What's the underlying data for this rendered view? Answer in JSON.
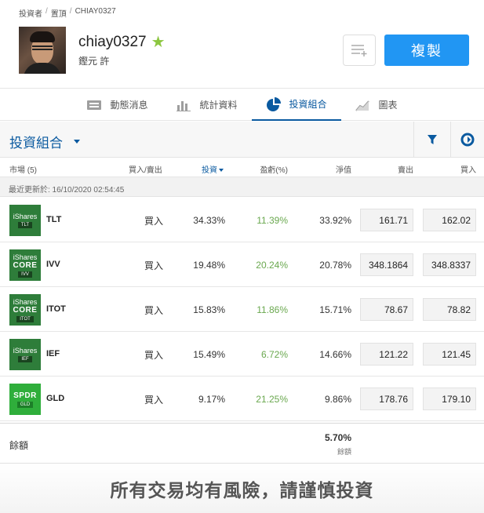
{
  "breadcrumb": {
    "items": [
      "投資者",
      "置頂",
      "CHIAY0327"
    ]
  },
  "profile": {
    "username": "chiay0327",
    "real_name": "鏗元 許"
  },
  "actions": {
    "copy_label": "複製"
  },
  "tabs": [
    {
      "label": "動態消息",
      "icon": "news-icon"
    },
    {
      "label": "統計資料",
      "icon": "stats-icon"
    },
    {
      "label": "投資組合",
      "icon": "portfolio-icon",
      "active": true
    },
    {
      "label": "圖表",
      "icon": "chart-icon"
    }
  ],
  "portfolio": {
    "title": "投資組合",
    "columns": {
      "market": "市場 (5)",
      "direction": "買入/賣出",
      "invested": "投資",
      "pl": "盈虧(%)",
      "net_value": "淨值",
      "sell": "賣出",
      "buy": "買入"
    },
    "last_updated": "最近更新於: 16/10/2020 02:54:45",
    "rows": [
      {
        "symbol": "TLT",
        "brand": "iShares",
        "brand2": "",
        "logo_ticker": "TLT",
        "direction": "買入",
        "invested": "34.33%",
        "pl": "11.39%",
        "net_value": "33.92%",
        "sell": "161.71",
        "buy": "162.02"
      },
      {
        "symbol": "IVV",
        "brand": "iShares",
        "brand2": "CORE",
        "logo_ticker": "IVV",
        "direction": "買入",
        "invested": "19.48%",
        "pl": "20.24%",
        "net_value": "20.78%",
        "sell": "348.1864",
        "buy": "348.8337"
      },
      {
        "symbol": "ITOT",
        "brand": "iShares",
        "brand2": "CORE",
        "logo_ticker": "ITOT",
        "direction": "買入",
        "invested": "15.83%",
        "pl": "11.86%",
        "net_value": "15.71%",
        "sell": "78.67",
        "buy": "78.82"
      },
      {
        "symbol": "IEF",
        "brand": "iShares",
        "brand2": "",
        "logo_ticker": "IEF",
        "direction": "買入",
        "invested": "15.49%",
        "pl": "6.72%",
        "net_value": "14.66%",
        "sell": "121.22",
        "buy": "121.45"
      },
      {
        "symbol": "GLD",
        "brand": "",
        "brand2": "SPDR",
        "logo_ticker": "GLD",
        "direction": "買入",
        "invested": "9.17%",
        "pl": "21.25%",
        "net_value": "9.86%",
        "sell": "178.76",
        "buy": "179.10"
      }
    ],
    "cash": {
      "label": "餘額",
      "value": "5.70%",
      "sub": "餘額"
    }
  },
  "banner": {
    "text": "所有交易均有風險，請謹慎投資"
  },
  "colors": {
    "accent": "#0a5aa0",
    "button": "#2196f3",
    "positive": "#6aa84f",
    "star": "#8cc63f"
  }
}
